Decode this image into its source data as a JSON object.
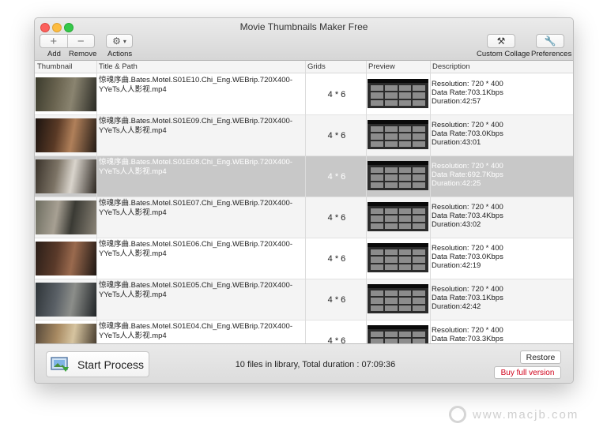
{
  "window": {
    "title": "Movie Thumbnails Maker Free"
  },
  "toolbar": {
    "add_label": "Add",
    "remove_label": "Remove",
    "actions_label": "Actions",
    "custom_collage_label": "Custom Collage",
    "preferences_label": "Preferences",
    "add_symbol": "+",
    "remove_symbol": "−"
  },
  "table": {
    "columns": [
      "Thumbnail",
      "Title & Path",
      "Grids",
      "Preview",
      "Description"
    ],
    "rows": [
      {
        "title": "惊魂序曲.Bates.Motel.S01E10.Chi_Eng.WEBrip.720X400-YYeTs人人影视.mp4",
        "grids": "4 * 6",
        "resolution": "Resolution: 720 * 400",
        "rate": "Data Rate:703.1Kbps",
        "duration": "Duration:42:57",
        "thumb": [
          "#3b3b2d",
          "#6a6450",
          "#8a8470",
          "#2a2a24"
        ]
      },
      {
        "title": "惊魂序曲.Bates.Motel.S01E09.Chi_Eng.WEBrip.720X400-YYeTs人人影视.mp4",
        "grids": "4 * 6",
        "resolution": "Resolution: 720 * 400",
        "rate": "Data Rate:703.0Kbps",
        "duration": "Duration:43:01",
        "thumb": [
          "#1c1410",
          "#5a3a26",
          "#b0805a",
          "#231a14"
        ]
      },
      {
        "title": "惊魂序曲.Bates.Motel.S01E08.Chi_Eng.WEBrip.720X400-YYeTs人人影视.mp4",
        "grids": "4 * 6",
        "resolution": "Resolution: 720 * 400",
        "rate": "Data Rate:692.7Kbps",
        "duration": "Duration:42:25",
        "thumb": [
          "#3a332b",
          "#7d7466",
          "#d9d4cc",
          "#2c2620"
        ]
      },
      {
        "title": "惊魂序曲.Bates.Motel.S01E07.Chi_Eng.WEBrip.720X400-YYeTs人人影视.mp4",
        "grids": "4 * 6",
        "resolution": "Resolution: 720 * 400",
        "rate": "Data Rate:703.4Kbps",
        "duration": "Duration:43:02",
        "thumb": [
          "#6d6d60",
          "#a7a093",
          "#3a3a34",
          "#8a8376"
        ]
      },
      {
        "title": "惊魂序曲.Bates.Motel.S01E06.Chi_Eng.WEBrip.720X400-YYeTs人人影视.mp4",
        "grids": "4 * 6",
        "resolution": "Resolution: 720 * 400",
        "rate": "Data Rate:703.0Kbps",
        "duration": "Duration:42:19",
        "thumb": [
          "#2a1e18",
          "#5a3a2a",
          "#9a6a4e",
          "#1e1612"
        ]
      },
      {
        "title": "惊魂序曲.Bates.Motel.S01E05.Chi_Eng.WEBrip.720X400-YYeTs人人影视.mp4",
        "grids": "4 * 6",
        "resolution": "Resolution: 720 * 400",
        "rate": "Data Rate:703.1Kbps",
        "duration": "Duration:42:42",
        "thumb": [
          "#2e3438",
          "#5a6066",
          "#8c8e8a",
          "#1f2326"
        ]
      },
      {
        "title": "惊魂序曲.Bates.Motel.S01E04.Chi_Eng.WEBrip.720X400-YYeTs人人影视.mp4",
        "grids": "4 * 6",
        "resolution": "Resolution: 720 * 400",
        "rate": "Data Rate:703.3Kbps",
        "duration": "",
        "thumb": [
          "#55483a",
          "#a88a62",
          "#d6c4a0",
          "#3a3024"
        ]
      }
    ],
    "selected_row_index": 2
  },
  "footer": {
    "start_label": "Start Process",
    "status": "10 files in library, Total duration : 07:09:36",
    "restore_label": "Restore",
    "buy_label": "Buy full version"
  },
  "watermark": {
    "text": "www.macjb.com"
  },
  "colors": {
    "selected_row": "#c8c8c8",
    "buy_text": "#d0021b"
  }
}
